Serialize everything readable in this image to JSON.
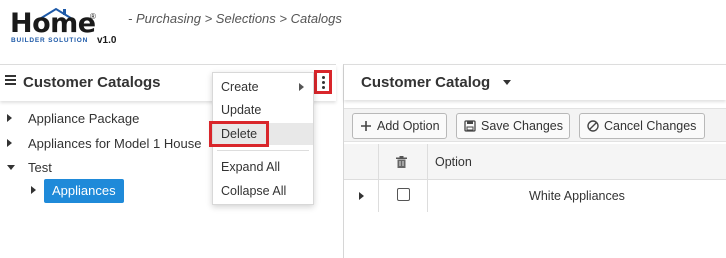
{
  "header": {
    "logo_word": "Home",
    "logo_reg": "®",
    "logo_sub": "BUILDER SOLUTION",
    "logo_version": "v1.0",
    "breadcrumb": "- Purchasing > Selections > Catalogs"
  },
  "left_panel": {
    "title": "Customer Catalogs",
    "tree": [
      {
        "label": "Appliance Package",
        "expanded": false
      },
      {
        "label": "Appliances for Model 1 House",
        "expanded": false
      },
      {
        "label": "Test",
        "expanded": true,
        "children": [
          {
            "label": "Appliances",
            "selected": true
          }
        ]
      }
    ]
  },
  "context_menu": {
    "items": [
      {
        "label": "Create",
        "has_submenu": true
      },
      {
        "label": "Update"
      },
      {
        "label": "Delete",
        "highlighted": true
      },
      {
        "label": "Expand All"
      },
      {
        "label": "Collapse All"
      }
    ]
  },
  "right_panel": {
    "title": "Customer Catalog",
    "toolbar": {
      "add_option": "Add Option",
      "save_changes": "Save Changes",
      "cancel_changes": "Cancel Changes"
    },
    "grid": {
      "column_option": "Option",
      "rows": [
        {
          "option": "White Appliances",
          "checked": false
        }
      ]
    }
  },
  "colors": {
    "accent_blue": "#1f8ad9",
    "highlight_red": "#d9262b",
    "logo_blue": "#1e5aa8"
  },
  "icons": [
    "hamburger-icon",
    "kebab-icon",
    "chevron-right-icon",
    "chevron-down-icon",
    "plus-icon",
    "save-icon",
    "cancel-icon",
    "trash-icon"
  ]
}
